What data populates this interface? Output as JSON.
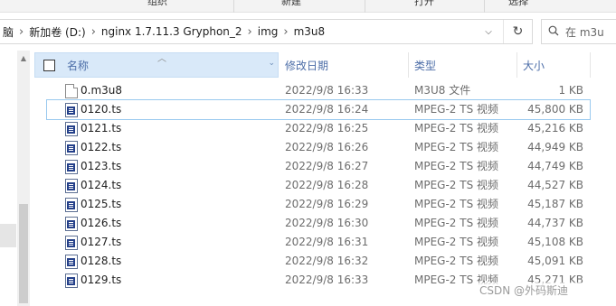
{
  "ribbon": {
    "groups": [
      "组织",
      "新建",
      "打开",
      "选择"
    ]
  },
  "address": {
    "crumbs": [
      "脑",
      "新加卷 (D:)",
      "nginx 1.7.11.3 Gryphon_2",
      "img",
      "m3u8"
    ],
    "refresh_icon": "refresh-icon",
    "search_placeholder": "在 m3u"
  },
  "columns": {
    "name": "名称",
    "date": "修改日期",
    "type": "类型",
    "size": "大小"
  },
  "files": [
    {
      "name": "0.m3u8",
      "date": "2022/9/8 16:33",
      "type": "M3U8 文件",
      "size": "1 KB",
      "icon": "document-icon"
    },
    {
      "name": "0120.ts",
      "date": "2022/9/8 16:24",
      "type": "MPEG-2 TS 视频",
      "size": "45,800 KB",
      "icon": "ts-video-icon",
      "selected": true
    },
    {
      "name": "0121.ts",
      "date": "2022/9/8 16:25",
      "type": "MPEG-2 TS 视频",
      "size": "45,216 KB",
      "icon": "ts-video-icon"
    },
    {
      "name": "0122.ts",
      "date": "2022/9/8 16:26",
      "type": "MPEG-2 TS 视频",
      "size": "44,949 KB",
      "icon": "ts-video-icon"
    },
    {
      "name": "0123.ts",
      "date": "2022/9/8 16:27",
      "type": "MPEG-2 TS 视频",
      "size": "44,749 KB",
      "icon": "ts-video-icon"
    },
    {
      "name": "0124.ts",
      "date": "2022/9/8 16:28",
      "type": "MPEG-2 TS 视频",
      "size": "44,527 KB",
      "icon": "ts-video-icon"
    },
    {
      "name": "0125.ts",
      "date": "2022/9/8 16:29",
      "type": "MPEG-2 TS 视频",
      "size": "45,187 KB",
      "icon": "ts-video-icon"
    },
    {
      "name": "0126.ts",
      "date": "2022/9/8 16:30",
      "type": "MPEG-2 TS 视频",
      "size": "44,737 KB",
      "icon": "ts-video-icon"
    },
    {
      "name": "0127.ts",
      "date": "2022/9/8 16:31",
      "type": "MPEG-2 TS 视频",
      "size": "45,108 KB",
      "icon": "ts-video-icon"
    },
    {
      "name": "0128.ts",
      "date": "2022/9/8 16:32",
      "type": "MPEG-2 TS 视频",
      "size": "45,091 KB",
      "icon": "ts-video-icon"
    },
    {
      "name": "0129.ts",
      "date": "2022/9/8 16:33",
      "type": "MPEG-2 TS 视频",
      "size": "45,271 KB",
      "icon": "ts-video-icon"
    }
  ],
  "watermark": "CSDN @外码斯迪",
  "colors": {
    "header_text": "#4d6ea8",
    "header_selected_bg": "#d9e9f9",
    "selection_border": "#99c9ef"
  }
}
